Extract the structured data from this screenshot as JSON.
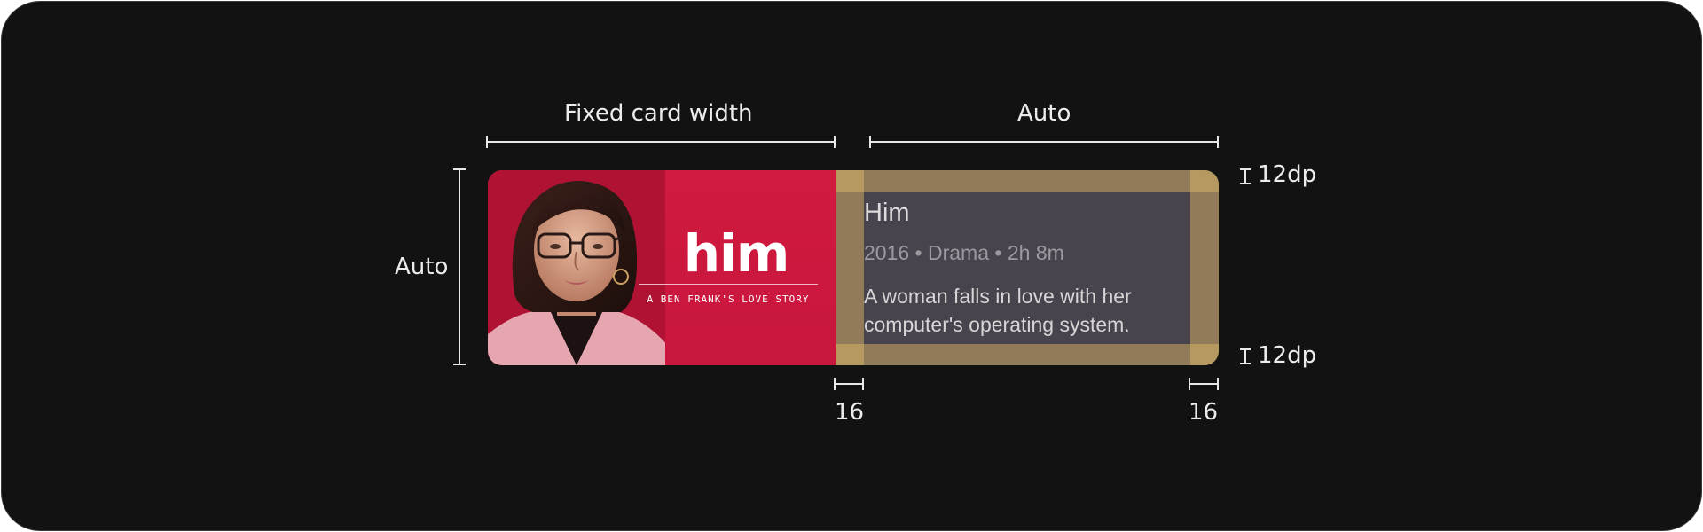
{
  "annotations": {
    "fixed_card_width": "Fixed card width",
    "auto_width": "Auto",
    "auto_height": "Auto",
    "top_padding": "12dp",
    "bottom_padding": "12dp",
    "left_padding": "16",
    "right_padding": "16"
  },
  "poster": {
    "title": "him",
    "tagline": "A BEN FRANK'S LOVE STORY"
  },
  "movie": {
    "title": "Him",
    "meta": "2016 • Drama • 2h 8m",
    "description": "A woman falls in love with her computer's operating system."
  },
  "colors": {
    "background": "#121212",
    "poster_red": "#c8163c",
    "card_surface": "#48434c",
    "padding_overlay": "#be9e60",
    "annotation": "#ececec"
  }
}
